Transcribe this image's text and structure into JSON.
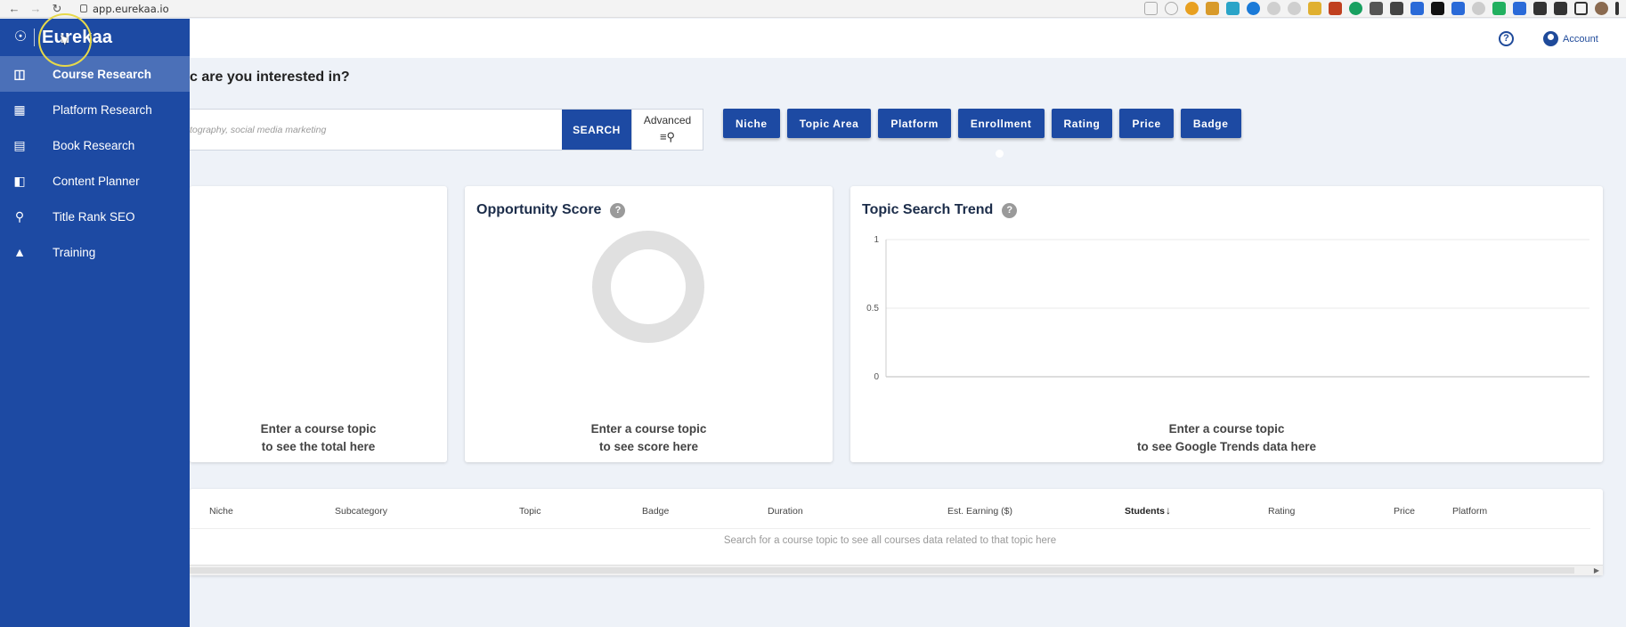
{
  "browser": {
    "url": "app.eurekaa.io"
  },
  "app": {
    "brand": "Eurekaa",
    "account_label": "Account"
  },
  "sidebar": {
    "items": [
      {
        "label": "Course Research",
        "icon": "course-research-icon"
      },
      {
        "label": "Platform Research",
        "icon": "platform-research-icon"
      },
      {
        "label": "Book Research",
        "icon": "book-icon"
      },
      {
        "label": "Content Planner",
        "icon": "planner-icon"
      },
      {
        "label": "Title Rank SEO",
        "icon": "search-icon"
      },
      {
        "label": "Training",
        "icon": "graduation-cap-icon"
      }
    ]
  },
  "main": {
    "heading": "c are you interested in?",
    "search": {
      "placeholder": "tography, social media marketing",
      "button": "SEARCH",
      "advanced": "Advanced"
    },
    "filters": [
      "Niche",
      "Topic Area",
      "Platform",
      "Enrollment",
      "Rating",
      "Price",
      "Badge"
    ],
    "cards": {
      "total": {
        "msg1": "Enter a course topic",
        "msg2": "to see the total here"
      },
      "opportunity": {
        "title": "Opportunity Score",
        "msg1": "Enter a course topic",
        "msg2": "to see score here"
      },
      "trend": {
        "title": "Topic Search Trend",
        "msg1": "Enter a course topic",
        "msg2": "to see Google Trends data here"
      }
    },
    "table": {
      "columns": [
        "Niche",
        "Subcategory",
        "Topic",
        "Badge",
        "Duration",
        "Est. Earning ($)",
        "Students",
        "Rating",
        "Price",
        "Platform"
      ],
      "empty_text": "Search for a course topic to see all courses data related to that topic here"
    }
  },
  "chart_data": {
    "type": "line",
    "title": "Topic Search Trend",
    "x": [],
    "series": [],
    "yticks": [
      "1",
      "0.5",
      "0"
    ],
    "ylim": [
      0,
      1
    ],
    "grid": true
  },
  "colors": {
    "primary": "#1d4aa3",
    "sidebar_active": "#4b70b8",
    "background": "#eef2f8"
  }
}
